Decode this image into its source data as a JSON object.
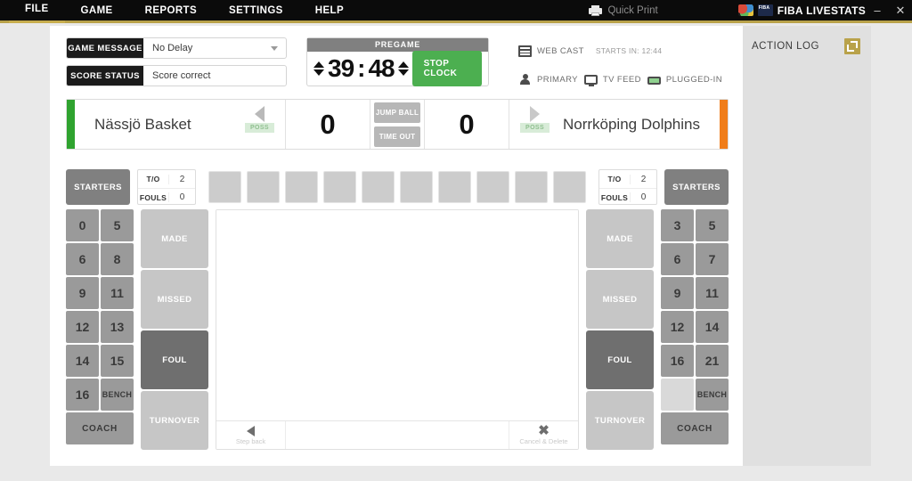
{
  "titlebar": {
    "menu": [
      {
        "label": "FILE",
        "active": true
      },
      {
        "label": "GAME",
        "active": false
      },
      {
        "label": "REPORTS",
        "active": false
      },
      {
        "label": "SETTINGS",
        "active": false
      },
      {
        "label": "HELP",
        "active": false
      }
    ],
    "quick_print": "Quick Print",
    "brand": "FIBA LIVESTATS",
    "minimize": "–",
    "close": "✕",
    "accent_color": "#b9a24a"
  },
  "controls": {
    "game_message_label": "GAME MESSAGE",
    "game_message_value": "No Delay",
    "score_status_label": "SCORE STATUS",
    "score_status_value": "Score correct"
  },
  "clock": {
    "period_label": "PREGAME",
    "minutes": "39",
    "separator": ":",
    "seconds": "48",
    "button_label": "STOP CLOCK",
    "button_color": "#4caf50"
  },
  "status": {
    "webcast": "WEB CAST",
    "starts_in": "STARTS IN: 12:44",
    "primary": "PRIMARY",
    "tv_feed": "TV FEED",
    "plugged_in": "PLUGGED-IN"
  },
  "scoreboard": {
    "home_team": "Nässjö Basket",
    "home_score": "0",
    "away_team": "Norrköping Dolphins",
    "away_score": "0",
    "poss_label": "POSS",
    "home_accent": "#2fa32f",
    "away_accent": "#f07d1a",
    "jump_ball": "JUMP BALL",
    "time_out": "TIME OUT"
  },
  "home_bench": {
    "starters_label": "STARTERS",
    "timeouts_key": "T/O",
    "timeouts_value": "2",
    "fouls_key": "FOULS",
    "fouls_value": "0",
    "numbers": [
      "0",
      "5",
      "6",
      "8",
      "9",
      "11",
      "12",
      "13",
      "14",
      "15",
      "16"
    ],
    "bench_label": "BENCH",
    "coach_label": "COACH"
  },
  "away_bench": {
    "starters_label": "STARTERS",
    "timeouts_key": "T/O",
    "timeouts_value": "2",
    "fouls_key": "FOULS",
    "fouls_value": "0",
    "numbers": [
      "3",
      "5",
      "6",
      "7",
      "9",
      "11",
      "12",
      "14",
      "16",
      "21"
    ],
    "bench_label": "BENCH",
    "coach_label": "COACH"
  },
  "actions": {
    "made": "MADE",
    "missed": "MISSED",
    "foul": "FOUL",
    "turnover": "TURNOVER",
    "active": "FOUL"
  },
  "court_bar": {
    "step_back": "Step back",
    "cancel_delete": "Cancel & Delete"
  },
  "action_log": {
    "title": "ACTION LOG",
    "entries": []
  }
}
